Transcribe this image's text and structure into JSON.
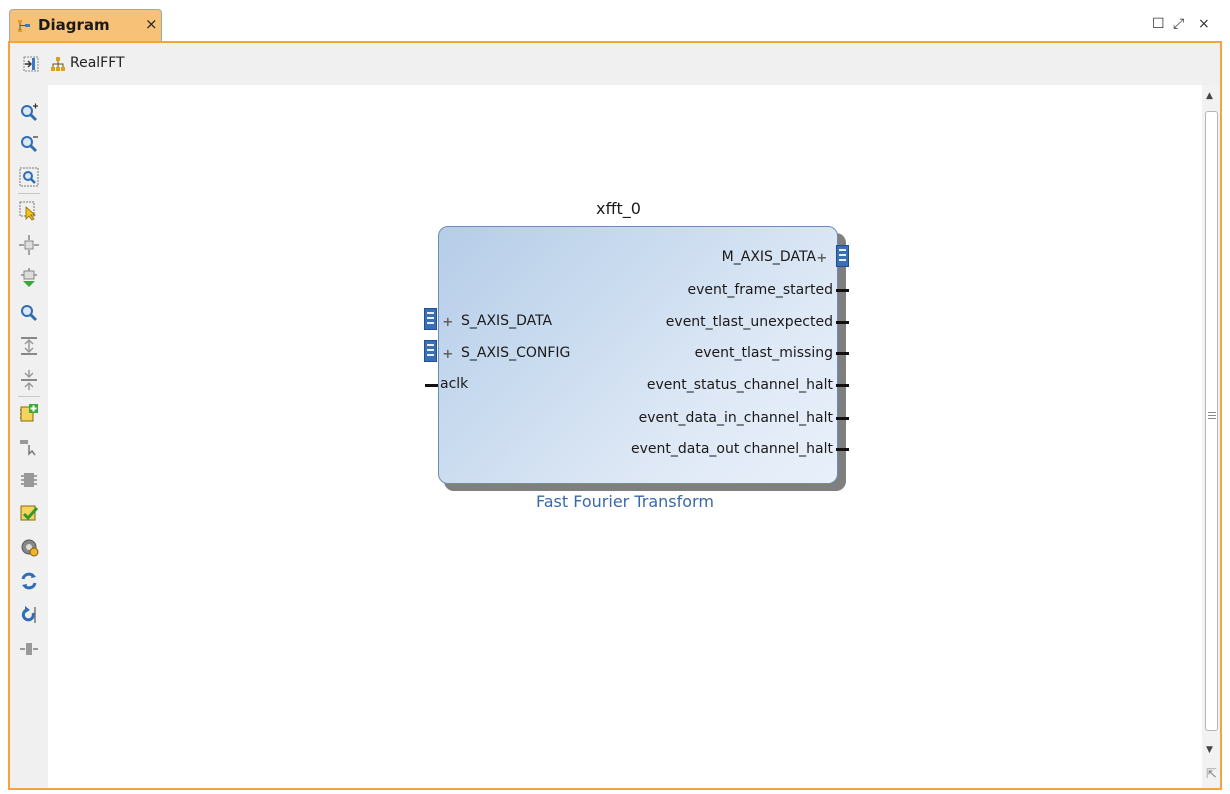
{
  "tab": {
    "label": "Diagram",
    "close": "×"
  },
  "window_controls": {
    "maximize": "☐",
    "restore": "⤢",
    "close": "×"
  },
  "header": {
    "breadcrumb": "RealFFT"
  },
  "block": {
    "instance_name": "xfft_0",
    "caption": "Fast Fourier Transform",
    "left_ports": [
      "S_AXIS_DATA",
      "S_AXIS_CONFIG",
      "aclk"
    ],
    "right_ports": [
      "M_AXIS_DATA",
      "event_frame_started",
      "event_tlast_unexpected",
      "event_tlast_missing",
      "event_status_channel_halt",
      "event_data_in_channel_halt",
      "event_data_out channel_halt"
    ]
  },
  "toolbar_icons": [
    "zoom-in-icon",
    "zoom-out-icon",
    "zoom-fit-icon",
    "select-area-icon",
    "fit-selection-icon",
    "auto-connect-icon",
    "search-icon",
    "collapse-icon",
    "expand-icon",
    "add-ip-icon",
    "pointer-icon",
    "hierarchy-icon",
    "validate-icon",
    "settings-icon",
    "regenerate-layout-icon",
    "refresh-icon",
    "port-icon"
  ],
  "colors": {
    "tab_active": "#f7c178",
    "frame": "#f4a33f",
    "block_fill": "#c9dbef",
    "caption": "#3b68a8"
  }
}
